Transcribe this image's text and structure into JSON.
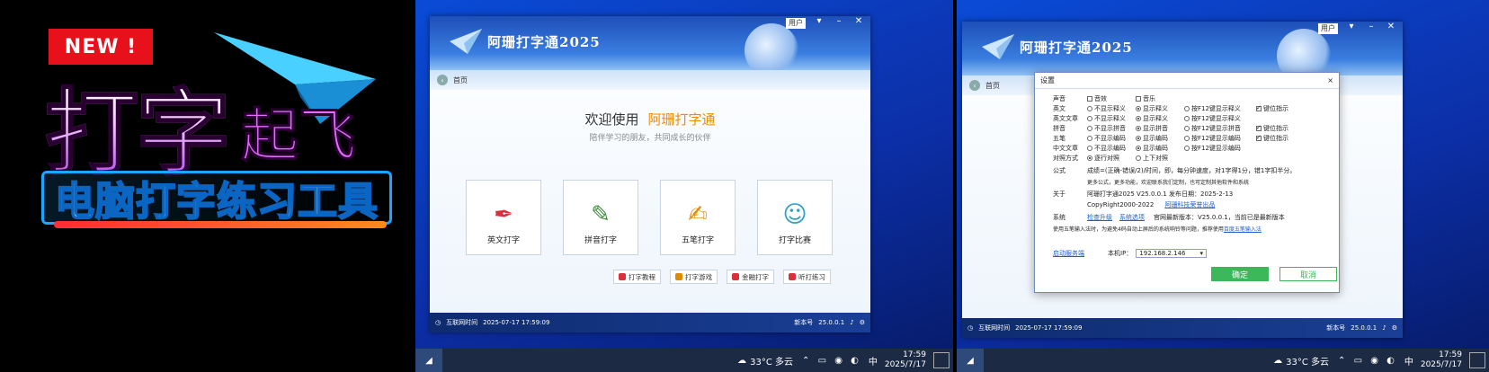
{
  "promo": {
    "badge": "NEW !",
    "line1_big": "打字",
    "line1_mid": "起飞",
    "line2": "电脑打字练习工具"
  },
  "app": {
    "title": "阿珊打字通2025",
    "user_tag": "用户",
    "crumb": "首页",
    "welcome_prefix": "欢迎使用",
    "welcome_app": "阿珊打字通",
    "subtitle": "陪伴学习的朋友，共同成长的伙伴",
    "tiles": [
      {
        "label": "英文打字",
        "icon": "quill-icon"
      },
      {
        "label": "拼音打字",
        "icon": "pinyin-icon"
      },
      {
        "label": "五笔打字",
        "icon": "brush-icon"
      },
      {
        "label": "打字比赛",
        "icon": "contest-icon"
      }
    ],
    "links": [
      {
        "label": "打字教程",
        "color": "#d9303b"
      },
      {
        "label": "打字游戏",
        "color": "#e08a00"
      },
      {
        "label": "金融打字",
        "color": "#d9303b"
      },
      {
        "label": "听打练习",
        "color": "#d9303b"
      }
    ],
    "status_left": "互联网时间",
    "status_time": "2025-07-17 17:59:09",
    "status_version_label": "新本号",
    "status_version": "25.0.0.1"
  },
  "settings": {
    "title": "设置",
    "close": "×",
    "rows": [
      {
        "key": "声音",
        "options": [
          {
            "type": "check",
            "on": false,
            "label": "音效"
          },
          {
            "type": "check",
            "on": false,
            "label": "音乐"
          }
        ]
      },
      {
        "key": "英文",
        "options": [
          {
            "type": "radio",
            "on": false,
            "label": "不显示释义"
          },
          {
            "type": "radio",
            "on": true,
            "label": "显示释义"
          },
          {
            "type": "radio",
            "on": false,
            "label": "按F12键显示释义"
          },
          {
            "type": "check",
            "on": true,
            "label": "键位指示"
          }
        ]
      },
      {
        "key": "英文文章",
        "options": [
          {
            "type": "radio",
            "on": false,
            "label": "不显示释义"
          },
          {
            "type": "radio",
            "on": true,
            "label": "显示释义"
          },
          {
            "type": "radio",
            "on": false,
            "label": "按F12键显示释义"
          }
        ]
      },
      {
        "key": "拼音",
        "options": [
          {
            "type": "radio",
            "on": false,
            "label": "不显示拼音"
          },
          {
            "type": "radio",
            "on": true,
            "label": "显示拼音"
          },
          {
            "type": "radio",
            "on": false,
            "label": "按F12键显示拼音"
          },
          {
            "type": "check",
            "on": true,
            "label": "键位指示"
          }
        ]
      },
      {
        "key": "五笔",
        "options": [
          {
            "type": "radio",
            "on": false,
            "label": "不显示编码"
          },
          {
            "type": "radio",
            "on": true,
            "label": "显示编码"
          },
          {
            "type": "radio",
            "on": false,
            "label": "按F12键显示编码"
          },
          {
            "type": "check",
            "on": true,
            "label": "键位指示"
          }
        ]
      },
      {
        "key": "中文文章",
        "options": [
          {
            "type": "radio",
            "on": false,
            "label": "不显示编码"
          },
          {
            "type": "radio",
            "on": true,
            "label": "显示编码"
          },
          {
            "type": "radio",
            "on": false,
            "label": "按F12键显示编码"
          }
        ]
      },
      {
        "key": "对照方式",
        "options": [
          {
            "type": "radio",
            "on": true,
            "label": "逐行对照"
          },
          {
            "type": "radio",
            "on": false,
            "label": "上下对照"
          }
        ]
      }
    ],
    "formula_key": "公式",
    "formula": "成绩=(正确-错误/2)/时间，即，每分钟速度，对1字得1分，错1字扣半分。",
    "formula_note": "更多公式，更多功能，欢迎联系我们定制，也可定制其他软件和系统",
    "about_key": "关于",
    "about": "阿珊打字通2025 V25.0.0.1 发布日期：2025-2-13",
    "copyright": "CopyRight2000-2022",
    "company": "阿珊科技荣誉出品",
    "system_key": "系统",
    "check_update": "检查升级",
    "system_opts": "系统选项",
    "update_msg": "官网最新版本：V25.0.0.1，当前已是最新版本",
    "ime_note": "使用五笔输入法时，为避免4码自动上屏后的系统响铃等问题，推荐使用",
    "ime_link": "百度五笔输入法",
    "service": "启动服务端",
    "ip_label": "本机IP：",
    "ip_value": "192.168.2.146",
    "ok": "确定",
    "cancel": "取消"
  },
  "taskbar": {
    "weather": "33°C 多云",
    "ime": "中",
    "time": "17:59",
    "date": "2025/7/17"
  }
}
